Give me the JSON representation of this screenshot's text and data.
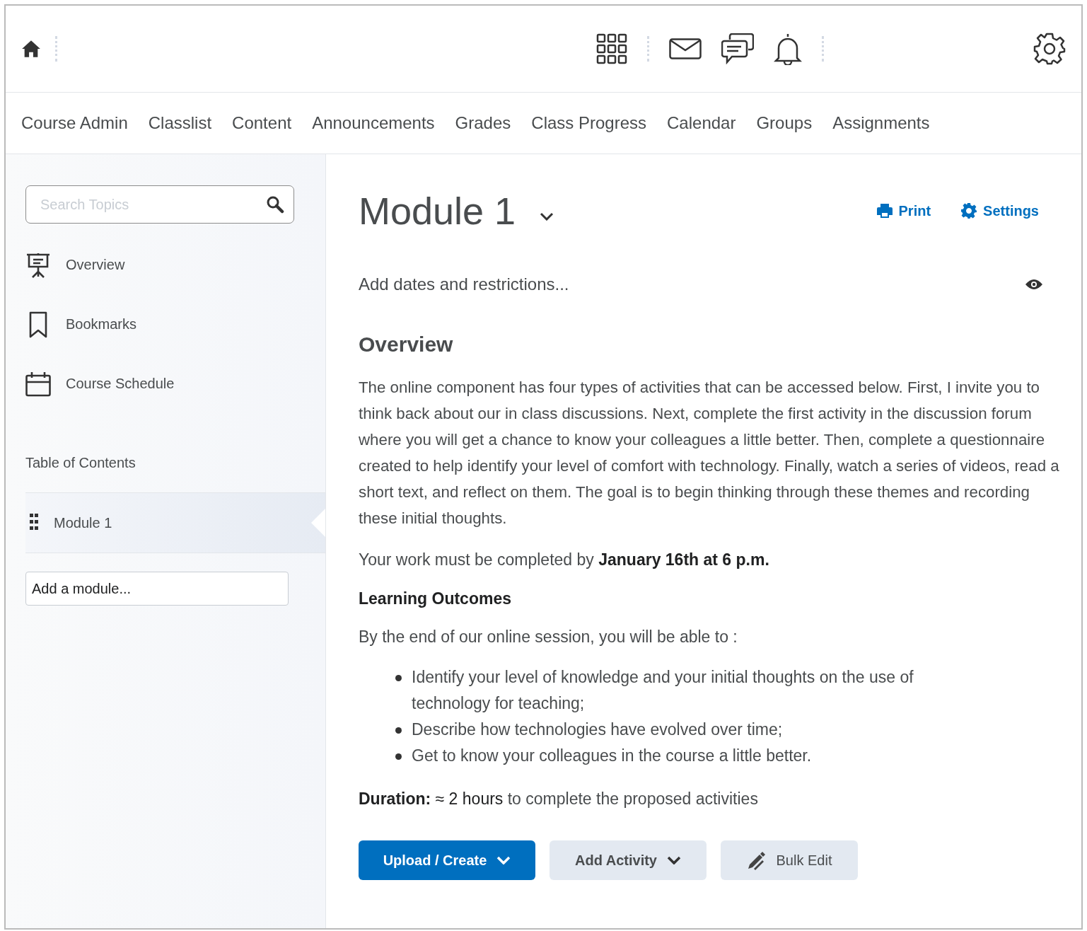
{
  "nav": [
    {
      "label": "Course Admin",
      "selected": false
    },
    {
      "label": "Classlist",
      "selected": false
    },
    {
      "label": "Content",
      "selected": false
    },
    {
      "label": "Announcements",
      "selected": false
    },
    {
      "label": "Grades",
      "selected": false
    },
    {
      "label": "Class Progress",
      "selected": false
    },
    {
      "label": "Calendar",
      "selected": false
    },
    {
      "label": "Groups",
      "selected": false
    },
    {
      "label": "Assignments",
      "selected": false
    }
  ],
  "sidebar": {
    "search": {
      "placeholder": "Search Topics"
    },
    "items": [
      {
        "label": "Overview",
        "kind": "overview"
      },
      {
        "label": "Bookmarks",
        "kind": "bookmark"
      },
      {
        "label": "Course Schedule",
        "kind": "schedule"
      }
    ],
    "toc_title": "Table of Contents",
    "modules": [
      {
        "label": "Module 1",
        "selected": true
      }
    ],
    "add_module": "Add a module..."
  },
  "content": {
    "title": "Module 1",
    "actions": [
      {
        "label": "Print",
        "kind": "print"
      },
      {
        "label": "Settings",
        "kind": "settings"
      }
    ],
    "dates_link": "Add dates and restrictions...",
    "heading": "Overview",
    "intro": "The online component has four types of activities that can be accessed below. First, I invite you to think back about our in class discussions. Next, complete the first activity in the discussion forum where you will get a chance to know your colleagues a little better. Then, complete a questionnaire created to help identify your level of comfort with technology. Finally, watch a series of videos, read a short text, and reflect on them. The goal is to begin thinking through these themes and recording these initial thoughts.",
    "deadline": "Your work must be completed by **January 16th at 6 p.m.**",
    "outcomes_heading": "Learning Outcomes",
    "outcomes_intro": "By the end of our online session, you will be able to :",
    "outcomes": [
      "Identify your level of knowledge and your initial thoughts on the use of technology for teaching;",
      "Describe how technologies have evolved over time;",
      "Get to know your colleagues in the course a little better."
    ],
    "duration": [
      {
        "text": "Duration:",
        "kind": "bold"
      },
      {
        "text": "≈ 2 hours",
        "kind": "dark"
      },
      {
        "text": "to complete the proposed activities",
        "kind": "plain"
      }
    ],
    "buttons": [
      {
        "label": "Upload / Create",
        "kind": "primary"
      },
      {
        "label": "Add Activity",
        "kind": "secondary"
      },
      {
        "label": "Bulk Edit",
        "kind": "edit"
      }
    ]
  }
}
